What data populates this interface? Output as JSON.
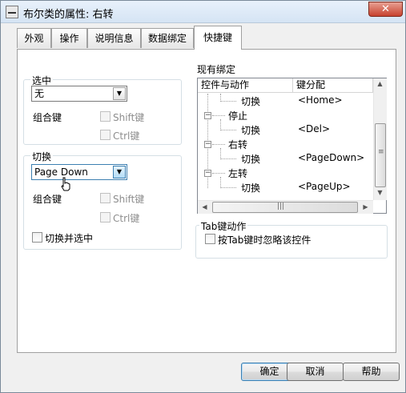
{
  "window": {
    "title": "布尔类的属性: 右转",
    "close_glyph": "✕"
  },
  "tabs": [
    {
      "label": "外观"
    },
    {
      "label": "操作"
    },
    {
      "label": "说明信息"
    },
    {
      "label": "数据绑定"
    },
    {
      "label": "快捷键",
      "active": true
    }
  ],
  "select_group": {
    "title": "选中",
    "dropdown_value": "无",
    "combo_label": "组合键",
    "shift_label": "Shift键",
    "ctrl_label": "Ctrl键"
  },
  "toggle_group": {
    "title": "切换",
    "dropdown_value": "Page Down",
    "combo_label": "组合键",
    "shift_label": "Shift键",
    "ctrl_label": "Ctrl键",
    "toggle_and_select_label": "切换并选中"
  },
  "bindings": {
    "title": "现有绑定",
    "columns": [
      "控件与动作",
      "键分配"
    ],
    "rows": [
      {
        "control": "切换",
        "key": "<Home>"
      },
      {
        "control": "停止",
        "key": ""
      },
      {
        "control": "切换",
        "key": "<Del>"
      },
      {
        "control": "右转",
        "key": ""
      },
      {
        "control": "切换",
        "key": "<PageDown>"
      },
      {
        "control": "左转",
        "key": ""
      },
      {
        "control": "切换",
        "key": "<PageUp>"
      }
    ],
    "collapse_glyph": "−",
    "arrows": {
      "up": "▲",
      "down": "▼",
      "left": "◀",
      "right": "▶"
    },
    "thumb_grip": "≡",
    "hthumb_grip": "|||"
  },
  "tab_action": {
    "title": "Tab键动作",
    "ignore_label": "按Tab键时忽略该控件"
  },
  "footer": {
    "ok": "确定",
    "cancel": "取消",
    "help": "帮助"
  },
  "icons": {
    "dropdown_arrow": "▼"
  }
}
